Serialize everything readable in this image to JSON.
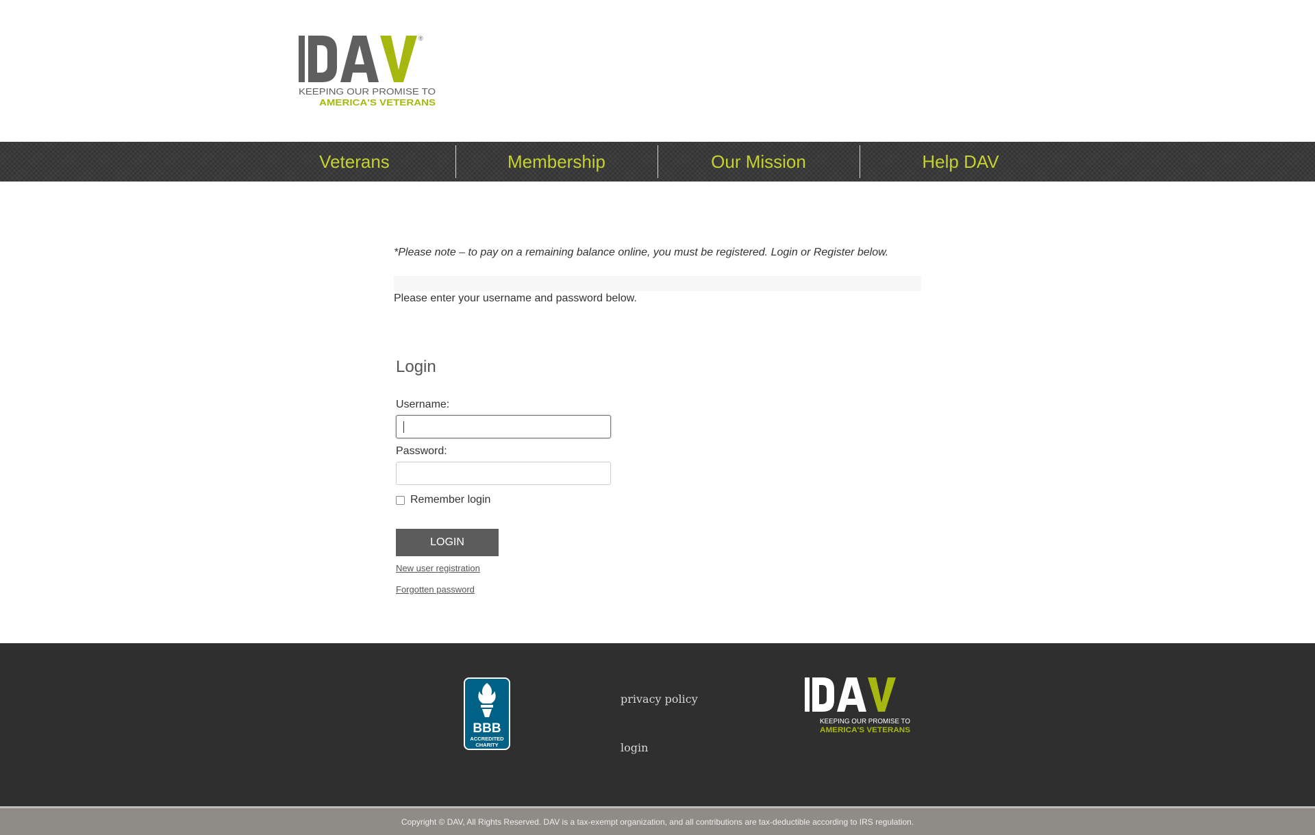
{
  "header": {
    "logo": {
      "mark": "DAV",
      "tagline_line1": "KEEPING OUR PROMISE TO",
      "tagline_line2": "AMERICA'S VETERANS",
      "registered": "®",
      "colors": {
        "gray": "#5f5f5f",
        "green": "#a6b80f"
      }
    }
  },
  "nav": {
    "items": [
      {
        "label": "Veterans"
      },
      {
        "label": "Membership"
      },
      {
        "label": "Our Mission"
      },
      {
        "label": "Help DAV"
      }
    ],
    "link_color": "#c6d12f"
  },
  "content": {
    "note": "*Please note – to pay on a remaining balance online, you must be registered.  Login or Register below.",
    "intro": "Please enter your username and password below.",
    "login": {
      "title": "Login",
      "username_label": "Username:",
      "username_value": "",
      "password_label": "Password:",
      "password_value": "",
      "remember_label": "Remember login",
      "remember_checked": false,
      "button_label": "LOGIN",
      "new_user_link": "New user registration",
      "forgot_link": "Forgotten password"
    }
  },
  "footer": {
    "bbb_badge": {
      "text1": "BBB",
      "text2": "ACCREDITED",
      "text3": "CHARITY",
      "icon": "torch-icon",
      "color": "#006187"
    },
    "links": [
      {
        "label": "privacy policy"
      },
      {
        "label": "login"
      }
    ],
    "logo": {
      "mark": "DAV",
      "tagline_line1": "KEEPING OUR PROMISE TO",
      "tagline_line2": "AMERICA'S VETERANS"
    },
    "copyright": "Copyright © DAV, All Rights Reserved. DAV is a tax-exempt organization, and all contributions are tax-deductible according to IRS regulation."
  }
}
